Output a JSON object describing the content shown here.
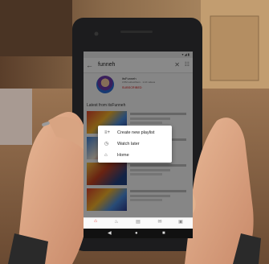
{
  "search": {
    "query": "funneh"
  },
  "channel": {
    "name": "itsFunneh",
    "meta": "3.5M subscribers · 1.1K videos",
    "subscribed_label": "SUBSCRIBED"
  },
  "section_title": "Latest from itsFunneh",
  "menu": {
    "items": [
      {
        "label": "Create new playlist",
        "icon": "playlist-add-icon"
      },
      {
        "label": "Watch later",
        "icon": "clock-icon"
      },
      {
        "label": "Home",
        "icon": "home-icon"
      }
    ]
  },
  "colors": {
    "accent": "#e52d27"
  }
}
